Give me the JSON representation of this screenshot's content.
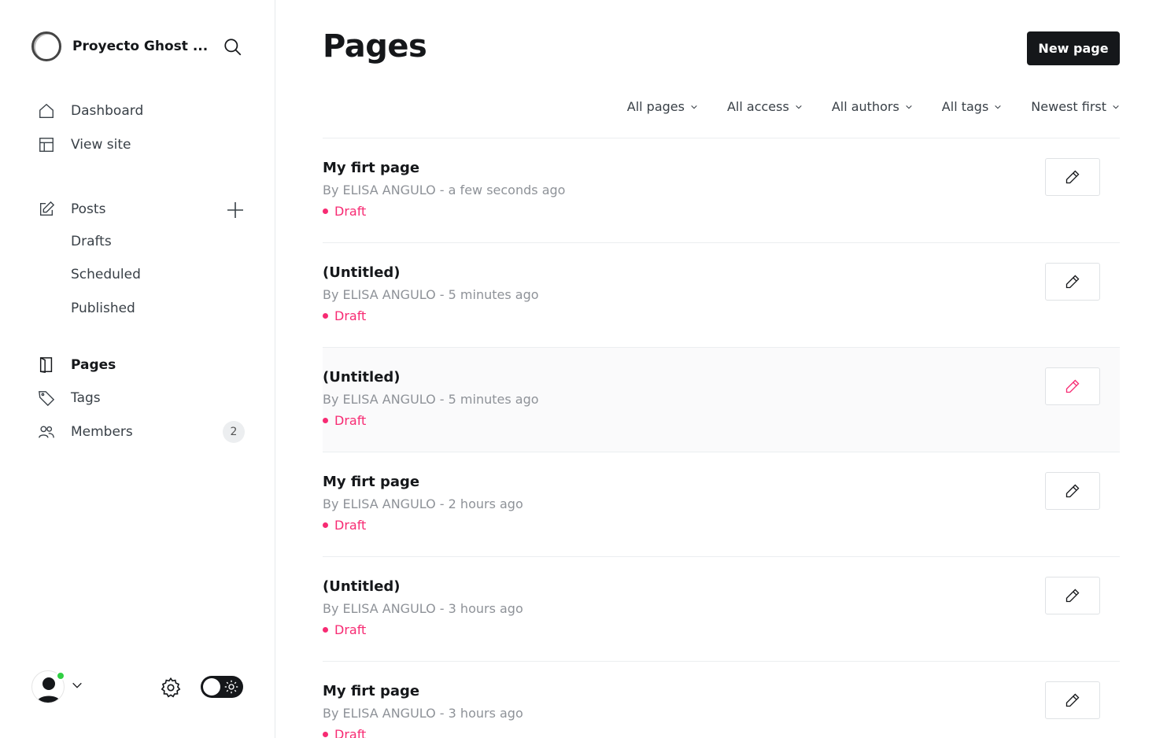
{
  "sidebar": {
    "site_name": "Proyecto Ghost ...",
    "nav": {
      "dashboard": "Dashboard",
      "view_site": "View site",
      "posts": "Posts",
      "drafts": "Drafts",
      "scheduled": "Scheduled",
      "published": "Published",
      "pages": "Pages",
      "tags": "Tags",
      "members": "Members",
      "members_count": "2"
    }
  },
  "main": {
    "title": "Pages",
    "new_button": "New page",
    "filters": [
      "All pages",
      "All access",
      "All authors",
      "All tags",
      "Newest first"
    ],
    "pages": [
      {
        "title": "My firt page",
        "meta": "By ELISA ANGULO - a few seconds ago",
        "status": "Draft"
      },
      {
        "title": "(Untitled)",
        "meta": "By ELISA ANGULO - 5 minutes ago",
        "status": "Draft"
      },
      {
        "title": "(Untitled)",
        "meta": "By ELISA ANGULO - 5 minutes ago",
        "status": "Draft"
      },
      {
        "title": "My firt page",
        "meta": "By ELISA ANGULO - 2 hours ago",
        "status": "Draft"
      },
      {
        "title": "(Untitled)",
        "meta": "By ELISA ANGULO - 3 hours ago",
        "status": "Draft"
      },
      {
        "title": "My firt page",
        "meta": "By ELISA ANGULO - 3 hours ago",
        "status": "Draft"
      }
    ]
  },
  "colors": {
    "accent": "#f72b73",
    "primary": "#15171a",
    "online": "#30cf43"
  }
}
